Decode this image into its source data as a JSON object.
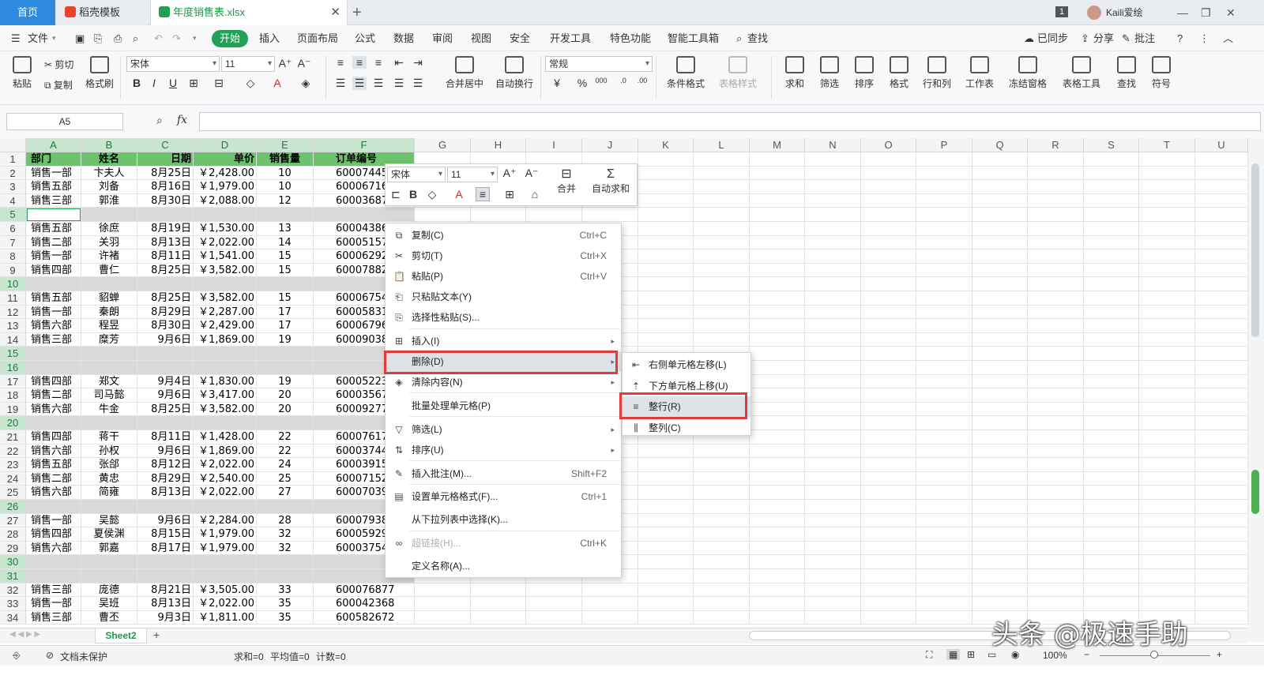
{
  "tabs": {
    "home": "首页",
    "template": "稻壳模板",
    "file": "年度销售表.xlsx",
    "badge": "1",
    "user": "Kaili爱绘"
  },
  "menu": [
    "文件",
    "开始",
    "插入",
    "页面布局",
    "公式",
    "数据",
    "审阅",
    "视图",
    "安全",
    "开发工具",
    "特色功能",
    "智能工具箱",
    "查找"
  ],
  "menu_right": [
    "已同步",
    "分享",
    "批注"
  ],
  "ribbon": {
    "paste": "粘贴",
    "cut": "剪切",
    "copy": "复制",
    "format_painter": "格式刷",
    "font": "宋体",
    "size": "11",
    "number_format": "常规",
    "merge": "合并居中",
    "wrap": "自动换行",
    "cond_format": "条件格式",
    "table_style": "表格样式",
    "sum": "求和",
    "filter": "筛选",
    "sort": "排序",
    "format": "格式",
    "rowcol": "行和列",
    "worksheet": "工作表",
    "freeze": "冻结窗格",
    "table_tools": "表格工具",
    "find": "查找",
    "symbol": "符号"
  },
  "namebox": "A5",
  "fx": "fx",
  "columns": [
    "A",
    "B",
    "C",
    "D",
    "E",
    "F",
    "G",
    "H",
    "I",
    "J",
    "K",
    "L",
    "M",
    "N",
    "O",
    "P",
    "Q",
    "R",
    "S",
    "T",
    "U"
  ],
  "header_row": [
    "部门",
    "姓名",
    "日期",
    "单价",
    "销售量",
    "订单编号"
  ],
  "rows": [
    {
      "n": "1",
      "cells": null
    },
    {
      "n": "2",
      "cells": [
        "销售一部",
        "卞夫人",
        "8月25日",
        "￥2,428.00",
        "10",
        "600074457"
      ]
    },
    {
      "n": "3",
      "cells": [
        "销售五部",
        "刘备",
        "8月16日",
        "￥1,979.00",
        "10",
        "600067163"
      ]
    },
    {
      "n": "4",
      "cells": [
        "销售三部",
        "郭淮",
        "8月30日",
        "￥2,088.00",
        "12",
        "600036872"
      ]
    },
    {
      "n": "5",
      "cells": []
    },
    {
      "n": "6",
      "cells": [
        "销售五部",
        "徐庶",
        "8月19日",
        "￥1,530.00",
        "13",
        "600043867"
      ]
    },
    {
      "n": "7",
      "cells": [
        "销售二部",
        "关羽",
        "8月13日",
        "￥2,022.00",
        "14",
        "600051573"
      ]
    },
    {
      "n": "8",
      "cells": [
        "销售一部",
        "许褚",
        "8月11日",
        "￥1,541.00",
        "15",
        "600062922"
      ]
    },
    {
      "n": "9",
      "cells": [
        "销售四部",
        "曹仁",
        "8月25日",
        "￥3,582.00",
        "15",
        "600078823"
      ]
    },
    {
      "n": "10",
      "cells": []
    },
    {
      "n": "11",
      "cells": [
        "销售五部",
        "貂蝉",
        "8月25日",
        "￥3,582.00",
        "15",
        "600067548"
      ]
    },
    {
      "n": "12",
      "cells": [
        "销售一部",
        "秦朗",
        "8月29日",
        "￥2,287.00",
        "17",
        "600058317"
      ]
    },
    {
      "n": "13",
      "cells": [
        "销售六部",
        "程昱",
        "8月30日",
        "￥2,429.00",
        "17",
        "600067962"
      ]
    },
    {
      "n": "14",
      "cells": [
        "销售三部",
        "糜芳",
        "9月6日",
        "￥1,869.00",
        "19",
        "600090381"
      ]
    },
    {
      "n": "15",
      "cells": []
    },
    {
      "n": "16",
      "cells": []
    },
    {
      "n": "17",
      "cells": [
        "销售四部",
        "郑文",
        "9月4日",
        "￥1,830.00",
        "19",
        "600052237"
      ]
    },
    {
      "n": "18",
      "cells": [
        "销售二部",
        "司马懿",
        "9月6日",
        "￥3,417.00",
        "20",
        "600035672"
      ]
    },
    {
      "n": "19",
      "cells": [
        "销售六部",
        "牛金",
        "8月25日",
        "￥3,582.00",
        "20",
        "600092778"
      ]
    },
    {
      "n": "20",
      "cells": []
    },
    {
      "n": "21",
      "cells": [
        "销售四部",
        "蒋干",
        "8月11日",
        "￥1,428.00",
        "22",
        "600076172"
      ]
    },
    {
      "n": "22",
      "cells": [
        "销售六部",
        "孙权",
        "9月6日",
        "￥1,869.00",
        "22",
        "600037443"
      ]
    },
    {
      "n": "23",
      "cells": [
        "销售五部",
        "张郃",
        "8月12日",
        "￥2,022.00",
        "24",
        "600039153"
      ]
    },
    {
      "n": "24",
      "cells": [
        "销售二部",
        "黄忠",
        "8月29日",
        "￥2,540.00",
        "25",
        "600071526"
      ]
    },
    {
      "n": "25",
      "cells": [
        "销售六部",
        "简雍",
        "8月13日",
        "￥2,022.00",
        "27",
        "600070395"
      ]
    },
    {
      "n": "26",
      "cells": []
    },
    {
      "n": "27",
      "cells": [
        "销售一部",
        "吴懿",
        "9月6日",
        "￥2,284.00",
        "28",
        "600079384"
      ]
    },
    {
      "n": "28",
      "cells": [
        "销售四部",
        "夏侯渊",
        "8月15日",
        "￥1,979.00",
        "32",
        "600059293"
      ]
    },
    {
      "n": "29",
      "cells": [
        "销售六部",
        "郭嘉",
        "8月17日",
        "￥1,979.00",
        "32",
        "600037546"
      ]
    },
    {
      "n": "30",
      "cells": []
    },
    {
      "n": "31",
      "cells": []
    },
    {
      "n": "32",
      "cells": [
        "销售三部",
        "庞德",
        "8月21日",
        "￥3,505.00",
        "33",
        "600076877"
      ]
    },
    {
      "n": "33",
      "cells": [
        "销售一部",
        "吴班",
        "8月13日",
        "￥2,022.00",
        "35",
        "600042368"
      ]
    },
    {
      "n": "34",
      "cells": [
        "销售三部",
        "曹丕",
        "9月3日",
        "￥1,811.00",
        "35",
        "600582672"
      ]
    }
  ],
  "float_toolbar": {
    "font": "宋体",
    "size": "11",
    "merge": "合并",
    "autosum": "自动求和"
  },
  "context_menu": [
    {
      "label": "复制(C)",
      "shortcut": "Ctrl+C",
      "icon": "copy-icon"
    },
    {
      "label": "剪切(T)",
      "shortcut": "Ctrl+X",
      "icon": "scissors-icon"
    },
    {
      "label": "粘贴(P)",
      "shortcut": "Ctrl+V",
      "icon": "paste-icon"
    },
    {
      "label": "只粘贴文本(Y)",
      "shortcut": "",
      "icon": "paste-text-icon"
    },
    {
      "label": "选择性粘贴(S)...",
      "shortcut": "",
      "icon": "paste-special-icon"
    },
    {
      "label": "插入(I)",
      "shortcut": "",
      "icon": "insert-icon",
      "submenu": true
    },
    {
      "label": "删除(D)",
      "shortcut": "",
      "icon": "",
      "submenu": true
    },
    {
      "label": "清除内容(N)",
      "shortcut": "",
      "icon": "eraser-icon",
      "submenu": true
    },
    {
      "label": "批量处理单元格(P)",
      "shortcut": "",
      "icon": ""
    },
    {
      "label": "筛选(L)",
      "shortcut": "",
      "icon": "filter-icon",
      "submenu": true
    },
    {
      "label": "排序(U)",
      "shortcut": "",
      "icon": "sort-icon",
      "submenu": true
    },
    {
      "label": "插入批注(M)...",
      "shortcut": "Shift+F2",
      "icon": "comment-icon"
    },
    {
      "label": "设置单元格格式(F)...",
      "shortcut": "Ctrl+1",
      "icon": "format-cells-icon"
    },
    {
      "label": "从下拉列表中选择(K)...",
      "shortcut": "",
      "icon": ""
    },
    {
      "label": "超链接(H)...",
      "shortcut": "Ctrl+K",
      "icon": "link-icon",
      "disabled": true
    },
    {
      "label": "定义名称(A)...",
      "shortcut": "",
      "icon": ""
    }
  ],
  "delete_submenu": [
    "右侧单元格左移(L)",
    "下方单元格上移(U)",
    "整行(R)",
    "整列(C)"
  ],
  "sheet_tab": "Sheet2",
  "status": {
    "protect": "文档未保护",
    "sum": "求和=0",
    "avg": "平均值=0",
    "count": "计数=0",
    "zoom": "100%"
  },
  "watermark": "头条 @极速手助"
}
